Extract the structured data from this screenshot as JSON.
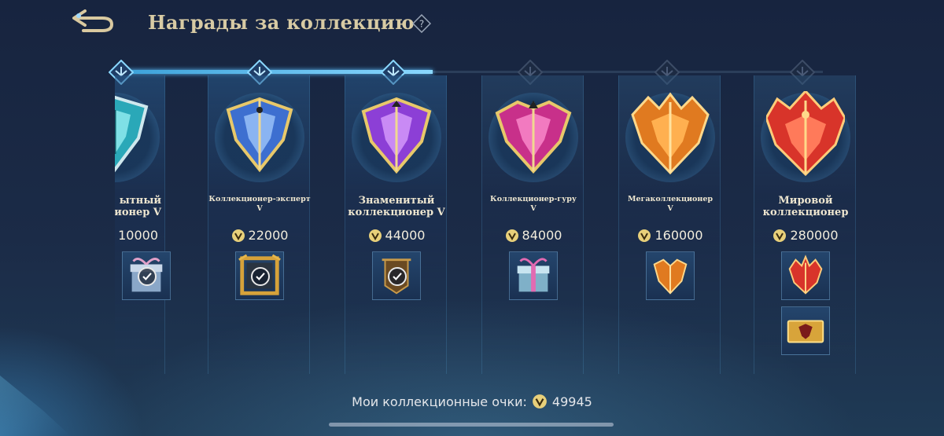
{
  "header": {
    "title": "Награды за коллекцию",
    "back_icon": "back-arrow-icon",
    "help_icon": "question-diamond-icon"
  },
  "progress": {
    "reached_tiers": 3,
    "total_tiers": 6
  },
  "tiers": [
    {
      "name": "ытный\nкционер V",
      "points": "10000",
      "medal_color": "#3cc4c8",
      "rewards": [
        {
          "icon": "gift-box-icon",
          "claimed": true
        }
      ]
    },
    {
      "name": "Коллекционер-эксперт\nV",
      "points": "22000",
      "medal_color": "#5a8ce0",
      "rewards": [
        {
          "icon": "gold-frame-icon",
          "claimed": true
        }
      ]
    },
    {
      "name": "Знаменитый\nколлекционер V",
      "points": "44000",
      "medal_color": "#a050e0",
      "rewards": [
        {
          "icon": "banner-shield-icon",
          "claimed": true
        }
      ]
    },
    {
      "name": "Коллекционер-гуру\nV",
      "points": "84000",
      "medal_color": "#e040a0",
      "rewards": [
        {
          "icon": "gift-box-icon",
          "claimed": false
        }
      ]
    },
    {
      "name": "Мегаколлекционер\nV",
      "points": "160000",
      "medal_color": "#f08a2a",
      "rewards": [
        {
          "icon": "orange-emblem-icon",
          "claimed": false
        }
      ]
    },
    {
      "name": "Мировой\nколлекционер",
      "points": "280000",
      "medal_color": "#e04a3a",
      "rewards": [
        {
          "icon": "red-emblem-icon",
          "claimed": false
        },
        {
          "icon": "gold-ticket-icon",
          "claimed": false
        }
      ]
    }
  ],
  "footer": {
    "label": "Мои коллекционные очки:",
    "points": "49945"
  },
  "colors": {
    "accent": "#8ad8ff",
    "gold": "#d8cba4"
  }
}
